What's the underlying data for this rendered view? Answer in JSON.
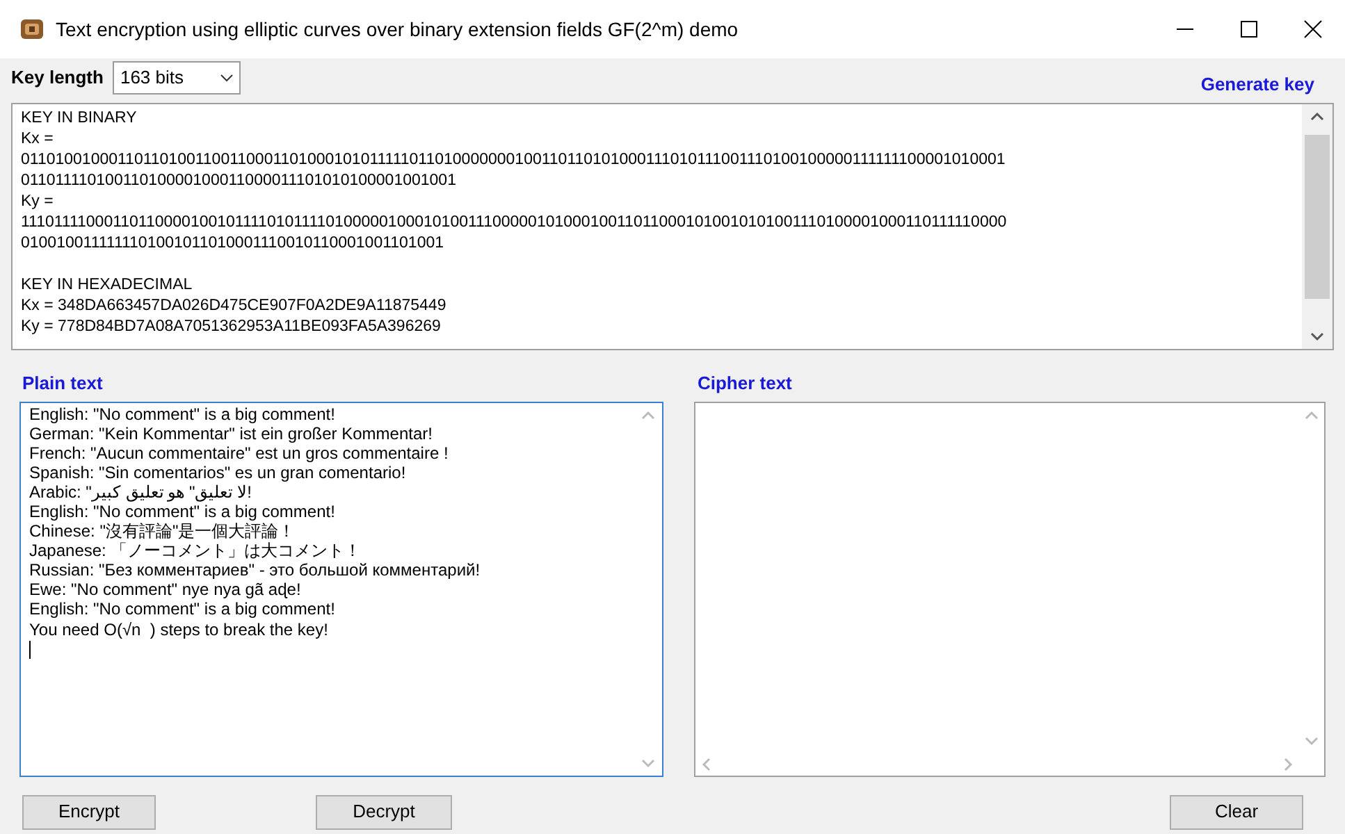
{
  "window": {
    "title": "Text encryption using elliptic curves over binary extension fields GF(2^m) demo"
  },
  "key_length": {
    "label": "Key length",
    "value": "163 bits"
  },
  "generate_key": "Generate key",
  "key_output": {
    "sections": [
      {
        "lines": [
          "KEY IN BINARY",
          "Kx =",
          "011010010001101101001100110001101000101011111011010000000100110110101000111010111001110100100000111111100001010001",
          "01101111010011010000100011000011101010100001001001",
          "Ky =",
          "111011110001101100001001011110101111010000010001010011100000101000100110110001010010101001110100001000110111110000",
          "0100100111111101001011010001110010110001001101001"
        ]
      },
      {
        "lines": [
          "KEY IN HEXADECIMAL",
          "Kx = 348DA663457DA026D475CE907F0A2DE9A11875449",
          "Ky = 778D84BD7A08A7051362953A11BE093FA5A396269"
        ]
      }
    ]
  },
  "plain_text": {
    "label": "Plain text",
    "lines": [
      "English: \"No comment\" is a big comment!",
      "German: \"Kein Kommentar\" ist ein großer Kommentar!",
      "French: \"Aucun commentaire\" est un gros commentaire !",
      "Spanish: \"Sin comentarios\" es un gran comentario!",
      "Arabic: \"لا تعليق\" هو تعليق كبير!",
      "English: \"No comment\" is a big comment!",
      "Chinese: \"沒有評論\"是一個大評論！",
      "Japanese: 「ノーコメント」は大コメント！",
      "Russian: \"Без комментариев\" - это большой комментарий!",
      "Ewe: \"No comment\" nye nya gã aɖe!",
      "English: \"No comment\" is a big comment!",
      "You need O(√n  ) steps to break the key!"
    ]
  },
  "cipher_text": {
    "label": "Cipher text"
  },
  "buttons": [
    {
      "label": "Encrypt"
    },
    {
      "label": "Decrypt"
    },
    {
      "label": "Clear"
    }
  ]
}
